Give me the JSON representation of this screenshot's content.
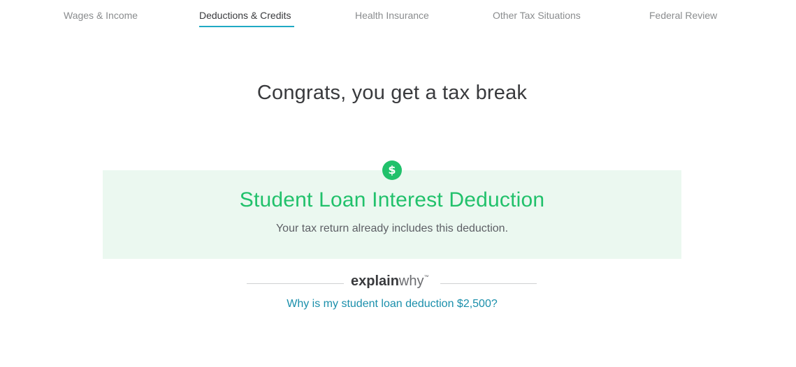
{
  "nav": {
    "tabs": [
      {
        "label": "Wages & Income"
      },
      {
        "label": "Deductions & Credits"
      },
      {
        "label": "Health Insurance"
      },
      {
        "label": "Other Tax Situations"
      },
      {
        "label": "Federal Review"
      }
    ],
    "active_tab": "Deductions & Credits"
  },
  "main": {
    "headline": "Congrats, you get a tax break"
  },
  "deduction_card": {
    "icon": "dollar-icon",
    "icon_glyph": "$",
    "title": "Student Loan Interest Deduction",
    "subtitle": "Your tax return already includes this deduction."
  },
  "explain_why": {
    "logo_bold": "explain",
    "logo_light": "why",
    "logo_tm": "™",
    "link_text": "Why is my student loan deduction $2,500?"
  },
  "colors": {
    "accent_teal": "#1fa9c4",
    "deduction_green": "#21c16b",
    "card_background": "#ebf8f0",
    "link_blue": "#1a8fab"
  }
}
